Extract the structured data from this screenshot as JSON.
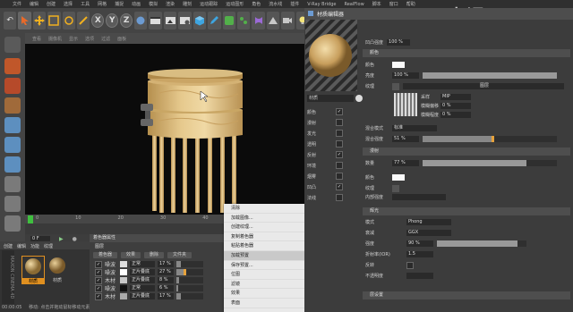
{
  "menubar": [
    "文件",
    "编辑",
    "创建",
    "选择",
    "工具",
    "网格",
    "捕捉",
    "动画",
    "模拟",
    "渲染",
    "雕刻",
    "运动跟踪",
    "运动图形",
    "角色",
    "流水线",
    "插件",
    "V-Ray Bridge",
    "RealFlow",
    "脚本",
    "窗口",
    "帮助"
  ],
  "menubar_right": "界面: 启动",
  "watermark": "虎课网",
  "toolbar": {
    "undo": "↶",
    "axes": [
      "X",
      "Y",
      "Z"
    ]
  },
  "viewport": {
    "menu": [
      "查看",
      "摄像机",
      "显示",
      "选项",
      "过滤",
      "面板"
    ]
  },
  "timeline": {
    "ticks": [
      "0",
      "10",
      "20",
      "30",
      "40",
      "50"
    ],
    "frame_field": "0 F",
    "start_label": "0 F"
  },
  "status": {
    "time": "00:00:05",
    "hint": "移动: 点击并拖动鼠标移动元素"
  },
  "material_manager": {
    "tabs": [
      "创建",
      "编辑",
      "功能",
      "纹理"
    ],
    "materials": [
      {
        "label": "材质"
      },
      {
        "label": "材质"
      }
    ],
    "brand": "MAXON CINEMA 4D"
  },
  "attributes": {
    "title": "着色器属性",
    "section": "图层",
    "tabs": [
      "着色器",
      "效果",
      "删除",
      "文件夹",
      "图层"
    ],
    "rows": [
      {
        "name": "噪波",
        "mode": "正常",
        "value": "17 %"
      },
      {
        "name": "噪波",
        "mode": "正片叠底",
        "value": "27 %"
      },
      {
        "name": "木材",
        "mode": "正片叠底",
        "value": "8 %"
      },
      {
        "name": "噪波",
        "mode": "正常",
        "value": "6 %"
      },
      {
        "name": "木材",
        "mode": "正片叠底",
        "value": "17 %"
      }
    ]
  },
  "context_menu": {
    "items": [
      "清除",
      "加载图像...",
      "创建纹理...",
      "复制着色器",
      "粘贴着色器",
      "加载预置",
      "保存预置...",
      "位图",
      "滤镜",
      "效果",
      "表面"
    ],
    "highlighted_index": 5,
    "submenu_hint": "噪波"
  },
  "material_editor": {
    "title": "材质编辑器",
    "material_name": "材质",
    "channels": [
      {
        "label": "颜色",
        "checked": true
      },
      {
        "label": "漫射",
        "checked": false
      },
      {
        "label": "发光",
        "checked": false
      },
      {
        "label": "透明",
        "checked": false
      },
      {
        "label": "反射",
        "checked": true
      },
      {
        "label": "环境",
        "checked": false
      },
      {
        "label": "烟雾",
        "checked": false
      },
      {
        "label": "凹凸",
        "checked": true
      },
      {
        "label": "法线",
        "checked": false
      }
    ],
    "top_field_label": "凹凸强度",
    "top_field_value": "100 %",
    "sections": {
      "color": "颜色",
      "diffuse": "漫射",
      "emit": "辉光",
      "bump": "凹凸"
    },
    "props": {
      "color_label": "颜色",
      "brightness_label": "亮度",
      "brightness_value": "100 %",
      "texture_label": "纹理",
      "texture_button": "图层",
      "sample_label": "采样",
      "sample_value": "MIP",
      "blur_offset_label": "模糊偏移",
      "blur_offset_value": "0 %",
      "blur_scale_label": "模糊程度",
      "blur_scale_value": "0 %",
      "mix_mode_label": "混合模式",
      "mix_mode_value": "标准",
      "mix_strength_label": "混合强度",
      "mix_strength_value": "51 %",
      "ratio_label": "数量",
      "ratio_value": "77 %",
      "color2_label": "颜色",
      "texture2_label": "纹理",
      "inner_label": "内部强度",
      "inner_value": "",
      "outer_label": "外部强度",
      "outer_value": "",
      "radius_label": "半径",
      "radius_value": "",
      "glow_section": "颜色",
      "glow_color_label": "模式",
      "glow_color_value": "Phong",
      "glow_mode_label": "衰减",
      "glow_mode_value": "GGX",
      "intensity_label": "强度",
      "intensity_value": "90 %",
      "refract_label": "折射率(IOR)",
      "refract_value": "1.5",
      "invert_label": "反转",
      "spec_label": "不透明度",
      "spec_value": "",
      "layer_section": "层设置"
    },
    "mix_strength_fraction": 0.51,
    "ratio_fraction": 0.77,
    "intensity_fraction": 0.9
  }
}
